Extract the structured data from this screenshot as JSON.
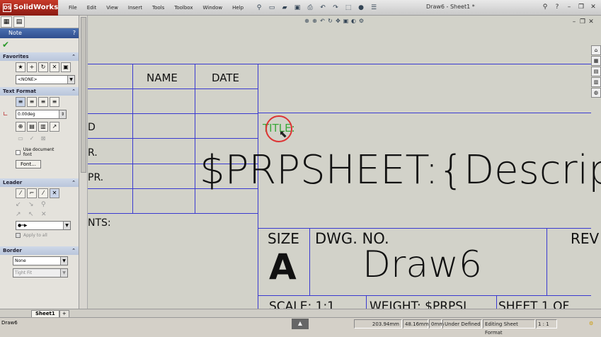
{
  "app": {
    "logo_text": "SolidWorks",
    "menus": [
      "File",
      "Edit",
      "View",
      "Insert",
      "Tools",
      "Toolbox",
      "Window",
      "Help"
    ],
    "document_title": "Draw6 - Sheet1 *"
  },
  "left_panel": {
    "note_title": "Note",
    "help_glyph": "?",
    "sections": {
      "favorites": "Favorites",
      "text_format": "Text Format",
      "leader": "Leader",
      "border": "Border"
    },
    "favorites_select": "<NONE>",
    "angle_value": "0.00deg",
    "use_document_font": "Use document font",
    "font_button": "Font...",
    "apply_to_all": "Apply to all",
    "border_style": "None",
    "border_size": "Tight Fit"
  },
  "drawing": {
    "name_header": "NAME",
    "date_header": "DATE",
    "left_labels": [
      "D",
      "R.",
      "PR."
    ],
    "comments_label": "NTS:",
    "title_label": "TITLE:",
    "description_text": "$PRPSHEET:{Descrip",
    "size_label": "SIZE",
    "size_value": "A",
    "dwg_no_label": "DWG.  NO.",
    "dwg_no_value": "Draw6",
    "rev_label": "REV",
    "scale_text": "SCALE: 1:1",
    "weight_text": "WEIGHT: $PRPSI",
    "sheet_text": "SHEET 1 OF"
  },
  "sheet_tabs": {
    "sheet1": "Sheet1"
  },
  "statusbar": {
    "name": "Draw6",
    "x": "203.94mm",
    "y": "48.16mm",
    "z": "0mm",
    "state": "Under Defined",
    "mode": "Editing Sheet Format",
    "scale": "1 : 1"
  }
}
